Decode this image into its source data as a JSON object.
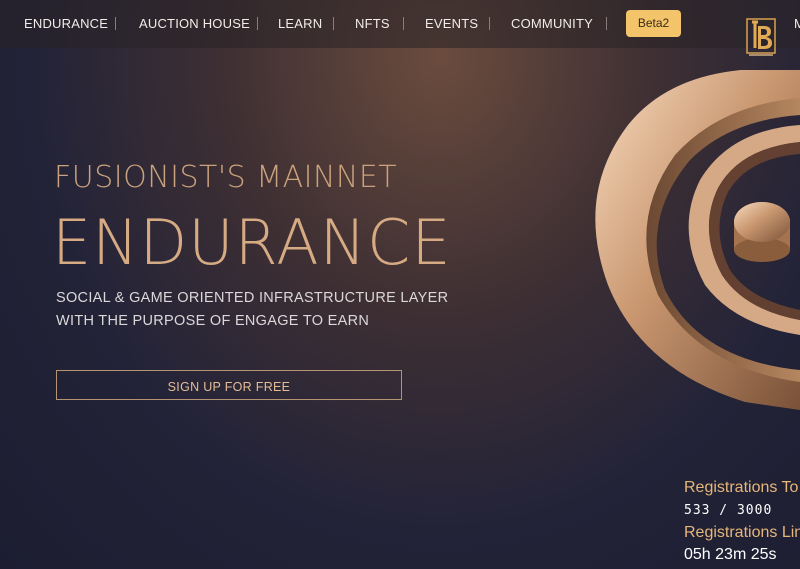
{
  "nav": {
    "items": [
      "ENDURANCE",
      "AUCTION HOUSE",
      "LEARN",
      "NFTS",
      "EVENTS",
      "COMMUNITY"
    ],
    "beta_label": "Beta2",
    "cut_item": "M"
  },
  "hero": {
    "subtitle": "FUSIONIST'S MAINNET",
    "title": "ENDURANCE",
    "desc_line1": "SOCIAL & GAME ORIENTED INFRASTRUCTURE LAYER",
    "desc_line2": "WITH THE PURPOSE OF ENGAGE TO EARN",
    "cta_label": "SIGN UP FOR FREE"
  },
  "registrations": {
    "total_label": "Registrations To",
    "total_value": "533 / 3000",
    "limit_label": "Registrations Lin",
    "time_left": "05h 23m 25s"
  },
  "colors": {
    "accent": "#f4c46b",
    "gold_text": "#d6ab84",
    "background": "#232338"
  },
  "icons": {
    "logo": "tb-logo",
    "hero_graphic": "gold-ring-logo"
  }
}
